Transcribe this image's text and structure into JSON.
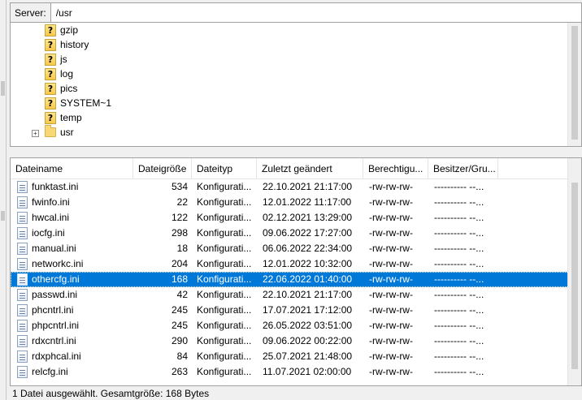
{
  "server": {
    "label": "Server:",
    "path": "/usr"
  },
  "tree": {
    "items": [
      {
        "label": "gzip",
        "icon": "unknown-folder-icon"
      },
      {
        "label": "history",
        "icon": "unknown-folder-icon"
      },
      {
        "label": "js",
        "icon": "unknown-folder-icon"
      },
      {
        "label": "log",
        "icon": "unknown-folder-icon"
      },
      {
        "label": "pics",
        "icon": "unknown-folder-icon"
      },
      {
        "label": "SYSTEM~1",
        "icon": "unknown-folder-icon"
      },
      {
        "label": "temp",
        "icon": "unknown-folder-icon"
      },
      {
        "label": "usr",
        "icon": "folder-icon",
        "expandable": true
      }
    ]
  },
  "filelist": {
    "columns": [
      "Dateiname",
      "Dateigröße",
      "Dateityp",
      "Zuletzt geändert",
      "Berechtigu...",
      "Besitzer/Gru..."
    ],
    "rows": [
      {
        "name": "funktast.ini",
        "size": "534",
        "type": "Konfigurati...",
        "modified": "22.10.2021 21:17:00",
        "perms": "-rw-rw-rw-",
        "owner": "---------- --..."
      },
      {
        "name": "fwinfo.ini",
        "size": "22",
        "type": "Konfigurati...",
        "modified": "12.01.2022 11:17:00",
        "perms": "-rw-rw-rw-",
        "owner": "---------- --..."
      },
      {
        "name": "hwcal.ini",
        "size": "122",
        "type": "Konfigurati...",
        "modified": "02.12.2021 13:29:00",
        "perms": "-rw-rw-rw-",
        "owner": "---------- --..."
      },
      {
        "name": "iocfg.ini",
        "size": "298",
        "type": "Konfigurati...",
        "modified": "09.06.2022 17:27:00",
        "perms": "-rw-rw-rw-",
        "owner": "---------- --..."
      },
      {
        "name": "manual.ini",
        "size": "18",
        "type": "Konfigurati...",
        "modified": "06.06.2022 22:34:00",
        "perms": "-rw-rw-rw-",
        "owner": "---------- --..."
      },
      {
        "name": "networkc.ini",
        "size": "204",
        "type": "Konfigurati...",
        "modified": "12.01.2022 10:32:00",
        "perms": "-rw-rw-rw-",
        "owner": "---------- --..."
      },
      {
        "name": "othercfg.ini",
        "size": "168",
        "type": "Konfigurati...",
        "modified": "22.06.2022 01:40:00",
        "perms": "-rw-rw-rw-",
        "owner": "---------- --...",
        "selected": true
      },
      {
        "name": "passwd.ini",
        "size": "42",
        "type": "Konfigurati...",
        "modified": "22.10.2021 21:17:00",
        "perms": "-rw-rw-rw-",
        "owner": "---------- --..."
      },
      {
        "name": "phcntrl.ini",
        "size": "245",
        "type": "Konfigurati...",
        "modified": "17.07.2021 17:12:00",
        "perms": "-rw-rw-rw-",
        "owner": "---------- --..."
      },
      {
        "name": "phpcntrl.ini",
        "size": "245",
        "type": "Konfigurati...",
        "modified": "26.05.2022 03:51:00",
        "perms": "-rw-rw-rw-",
        "owner": "---------- --..."
      },
      {
        "name": "rdxcntrl.ini",
        "size": "290",
        "type": "Konfigurati...",
        "modified": "09.06.2022 00:22:00",
        "perms": "-rw-rw-rw-",
        "owner": "---------- --..."
      },
      {
        "name": "rdxphcal.ini",
        "size": "84",
        "type": "Konfigurati...",
        "modified": "25.07.2021 21:48:00",
        "perms": "-rw-rw-rw-",
        "owner": "---------- --..."
      },
      {
        "name": "relcfg.ini",
        "size": "263",
        "type": "Konfigurati...",
        "modified": "11.07.2021 02:00:00",
        "perms": "-rw-rw-rw-",
        "owner": "---------- --..."
      }
    ]
  },
  "status": {
    "text": "1 Datei ausgewählt. Gesamtgröße: 168 Bytes"
  },
  "colors": {
    "selection": "#0078d7",
    "window_bg": "#f0f0f0"
  }
}
